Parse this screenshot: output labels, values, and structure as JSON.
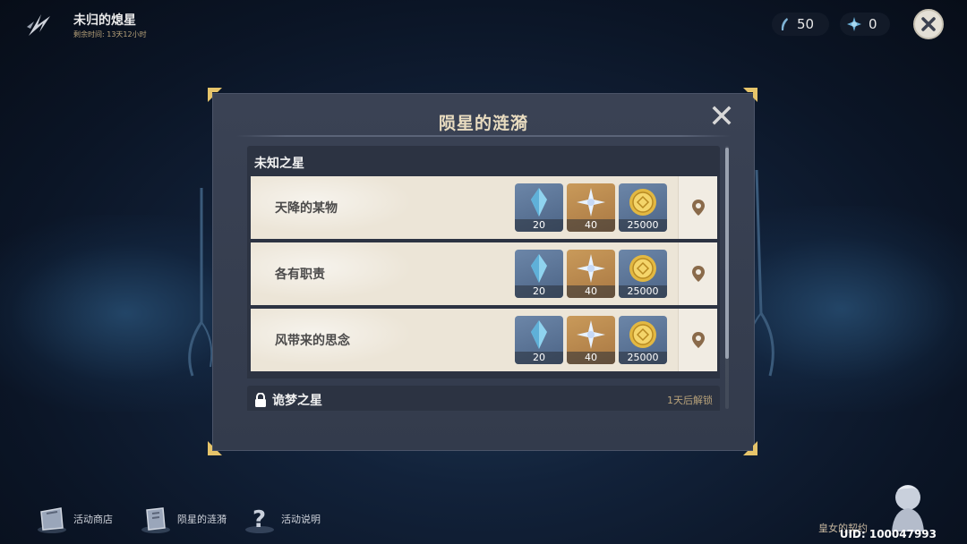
{
  "top_bar": {
    "event_title": "未归的熄星",
    "remaining_time": "剩余时间: 13天12小时",
    "resource1_value": "50",
    "resource2_value": "0"
  },
  "modal": {
    "title": "陨星的涟漪",
    "section_title": "未知之星",
    "quests": [
      {
        "name": "天降的某物",
        "rewards": [
          "20",
          "40",
          "25000"
        ]
      },
      {
        "name": "各有职责",
        "rewards": [
          "20",
          "40",
          "25000"
        ]
      },
      {
        "name": "风带来的思念",
        "rewards": [
          "20",
          "40",
          "25000"
        ]
      }
    ],
    "locked_section_title": "诡梦之星",
    "locked_note": "1天后解锁"
  },
  "bottom_nav": {
    "items": [
      {
        "label": "活动商店",
        "icon": "bag-icon"
      },
      {
        "label": "陨星的涟漪",
        "icon": "book-icon"
      },
      {
        "label": "活动说明",
        "icon": "question-icon"
      }
    ],
    "contract_label": "皇女的契约",
    "uid": "UID: 100047993"
  },
  "colors": {
    "accent_gold": "#b8a27a",
    "quest_row_bg": "#ece5d7",
    "modal_bg": "#3a4254"
  }
}
